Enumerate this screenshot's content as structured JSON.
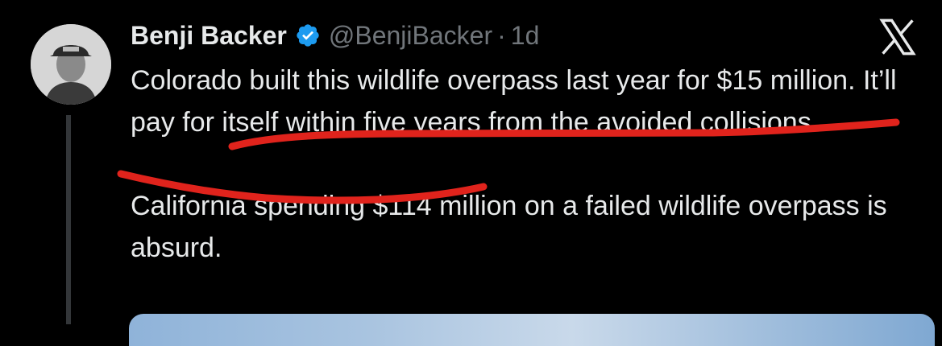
{
  "tweet": {
    "author": {
      "name": "Benji Backer",
      "handle": "@BenjiBacker",
      "verified": true
    },
    "separator": "·",
    "time": "1d",
    "paragraphs": [
      "Colorado built this wildlife overpass last year for $15 million. It’ll pay for itself within five years from the avoided collisions.",
      "California spending $114 million on a failed wildlife overpass is absurd."
    ]
  },
  "icons": {
    "verified": "verified-badge-icon",
    "platform": "x-logo-icon"
  },
  "colors": {
    "background": "#000000",
    "text": "#e7e9ea",
    "secondary": "#71767b",
    "verified": "#1d9bf0",
    "annotation": "#e0231c"
  }
}
